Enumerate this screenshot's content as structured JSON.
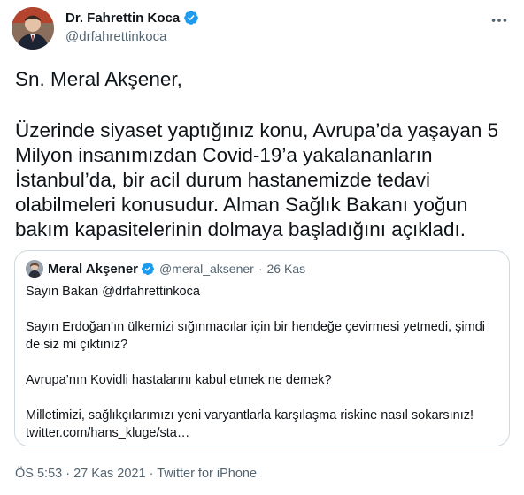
{
  "author": {
    "name": "Dr. Fahrettin Koca",
    "handle": "@drfahrettinkoca"
  },
  "tweet": {
    "greeting": "Sn. Meral Akşener,",
    "paragraph": "Üzerinde siyaset yaptığınız konu, Avrupa’da yaşayan 5 Milyon insanımızdan Covid-19’a yakalananların İstanbul’da, bir acil durum hastanemizde tedavi olabilmeleri konusudur. Alman Sağlık Bakanı yoğun bakım kapasitelerinin dolmaya başladığını açıkladı."
  },
  "quoted_tweet": {
    "name": "Meral Akşener",
    "handle": "@meral_aksener",
    "separator": "·",
    "date": "26 Kas",
    "line1": "Sayın Bakan @drfahrettinkoca",
    "line2": "Sayın Erdoğan’ın ülkemizi sığınmacılar için bir hendeğe çevirmesi yetmedi, şimdi de siz mi çıktınız?",
    "line3": "Avrupa’nın Kovidli hastalarını kabul etmek ne demek?",
    "line4": "Milletimizi, sağlıkçılarımızı yeni varyantlarla karşılaşma riskine nasıl sokarsınız!",
    "line5": "twitter.com/hans_kluge/sta…"
  },
  "footer": {
    "time": "ÖS 5:53",
    "separator1": "·",
    "date": "27 Kas 2021",
    "separator2": "·",
    "source": "Twitter for iPhone"
  },
  "icons": {
    "verified": "verified-badge-icon",
    "more": "more-options-icon"
  },
  "colors": {
    "verified_blue": "#1d9bf0",
    "secondary_text": "#536471",
    "border": "#cfd9de"
  }
}
